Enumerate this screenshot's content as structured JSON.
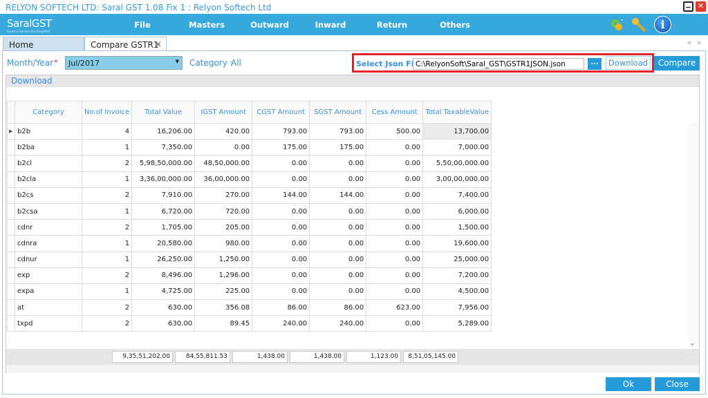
{
  "window": {
    "title": "RELYON SOFTECH LTD: Saral GST  1.08 Fix 1 : Relyon Softech Ltd",
    "minimize": "−",
    "close": "✕"
  },
  "logo": {
    "text": "SaralGST",
    "tagline": "Goods & Service Tax Simplified"
  },
  "menu": [
    {
      "label": "File"
    },
    {
      "label": "Masters"
    },
    {
      "label": "Outward"
    },
    {
      "label": "Inward"
    },
    {
      "label": "Return"
    },
    {
      "label": "Others"
    }
  ],
  "toolbar_icons": [
    "settings-gears-icon",
    "keys-icon",
    "info-icon"
  ],
  "tabs": [
    {
      "label": "Home"
    },
    {
      "label": "Compare GSTR1",
      "close": "×"
    }
  ],
  "filters": {
    "month_label": "Month/Year",
    "required": "*",
    "month_value": "Jul/2017",
    "category_label": "Category :",
    "category_value": "All"
  },
  "json": {
    "label": "Select Json File",
    "path": "C:\\RelyonSoft\\Saral_GST\\GSTR1JSON.json",
    "browse": "...",
    "download": "Download",
    "compare": "Compare"
  },
  "grid": {
    "download_link": "Download",
    "columns": [
      "Category",
      "No.of Invoice",
      "Total Value",
      "IGST Amount",
      "CGST Amount",
      "SGST Amount",
      "Cess Amount",
      "Total TaxableValue"
    ],
    "rows": [
      [
        "b2b",
        "4",
        "16,206.00",
        "420.00",
        "793.00",
        "793.00",
        "500.00",
        "13,700.00"
      ],
      [
        "b2ba",
        "1",
        "7,350.00",
        "0.00",
        "175.00",
        "175.00",
        "0.00",
        "7,000.00"
      ],
      [
        "b2cl",
        "2",
        "5,98,50,000.00",
        "48,50,000.00",
        "0.00",
        "0.00",
        "0.00",
        "5,50,00,000.00"
      ],
      [
        "b2cla",
        "1",
        "3,36,00,000.00",
        "36,00,000.00",
        "0.00",
        "0.00",
        "0.00",
        "3,00,00,000.00"
      ],
      [
        "b2cs",
        "2",
        "7,910.00",
        "270.00",
        "144.00",
        "144.00",
        "0.00",
        "7,400.00"
      ],
      [
        "b2csa",
        "1",
        "6,720.00",
        "720.00",
        "0.00",
        "0.00",
        "0.00",
        "6,000.00"
      ],
      [
        "cdnr",
        "2",
        "1,705.00",
        "205.00",
        "0.00",
        "0.00",
        "0.00",
        "1,500.00"
      ],
      [
        "cdnra",
        "1",
        "20,580.00",
        "980.00",
        "0.00",
        "0.00",
        "0.00",
        "19,600.00"
      ],
      [
        "cdnur",
        "1",
        "26,250.00",
        "1,250.00",
        "0.00",
        "0.00",
        "0.00",
        "25,000.00"
      ],
      [
        "exp",
        "2",
        "8,496.00",
        "1,296.00",
        "0.00",
        "0.00",
        "0.00",
        "7,200.00"
      ],
      [
        "expa",
        "1",
        "4,725.00",
        "225.00",
        "0.00",
        "0.00",
        "0.00",
        "4,500.00"
      ],
      [
        "at",
        "2",
        "630.00",
        "356.08",
        "86.00",
        "86.00",
        "623.00",
        "7,956.00"
      ],
      [
        "txpd",
        "2",
        "630.00",
        "89.45",
        "240.00",
        "240.00",
        "0.00",
        "5,289.00"
      ]
    ],
    "totals": [
      "9,35,51,202.00",
      "84,55,811.53",
      "1,438.00",
      "1,438.00",
      "1,123.00",
      "8,51,05,145.00"
    ]
  },
  "buttons": {
    "ok": "Ok",
    "close": "Close"
  },
  "colors": {
    "menubar": "#37a8dc",
    "accent": "#259bdc",
    "highlight": "#e8202a"
  }
}
